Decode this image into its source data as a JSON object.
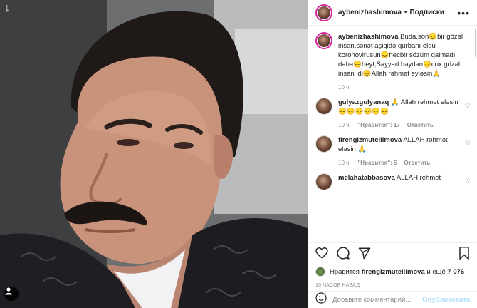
{
  "post": {
    "author": "aybenizhashimova",
    "follow_label": "Подписки",
    "separator": "•",
    "more": "•••"
  },
  "caption": {
    "author": "aybenizhashimova",
    "text": "Buda,son😞bir gözəl insan,sənət aşiqidə qurbanı oldu koronovirusun😞hecbir sözüm qalmadı daha😞heyf,Sayyad bəydən😞cox gözəl insan idi😞Allah rəhmət eyləsin🙏",
    "time": "10 ч."
  },
  "comments": [
    {
      "user": "gulyazgulyanaq",
      "text": "🙏 Allah rəhmət eləsin 😞😞😞😞😞😞",
      "time": "10 ч.",
      "likes": "\"Нравится\": 17",
      "reply": "Ответить"
    },
    {
      "user": "firengizmutellimova",
      "text": "ALLAH rəhmət eləsin 🙏",
      "time": "10 ч.",
      "likes": "\"Нравится\": 5",
      "reply": "Ответить"
    },
    {
      "user": "melahatabbasova",
      "text": "ALLAH rehmet"
    }
  ],
  "likes": {
    "prefix": "Нравится",
    "user": "firengizmutellimova",
    "middle": "и ещё",
    "count": "7 076"
  },
  "time_ago": "10 ЧАСОВ НАЗАД",
  "add_comment": {
    "placeholder": "Добавьте комментарий...",
    "publish": "Опубликовать"
  },
  "colors": {
    "ring": "#d6249f",
    "publish_disabled": "#b2dffc",
    "muted": "#8e8e8e"
  }
}
